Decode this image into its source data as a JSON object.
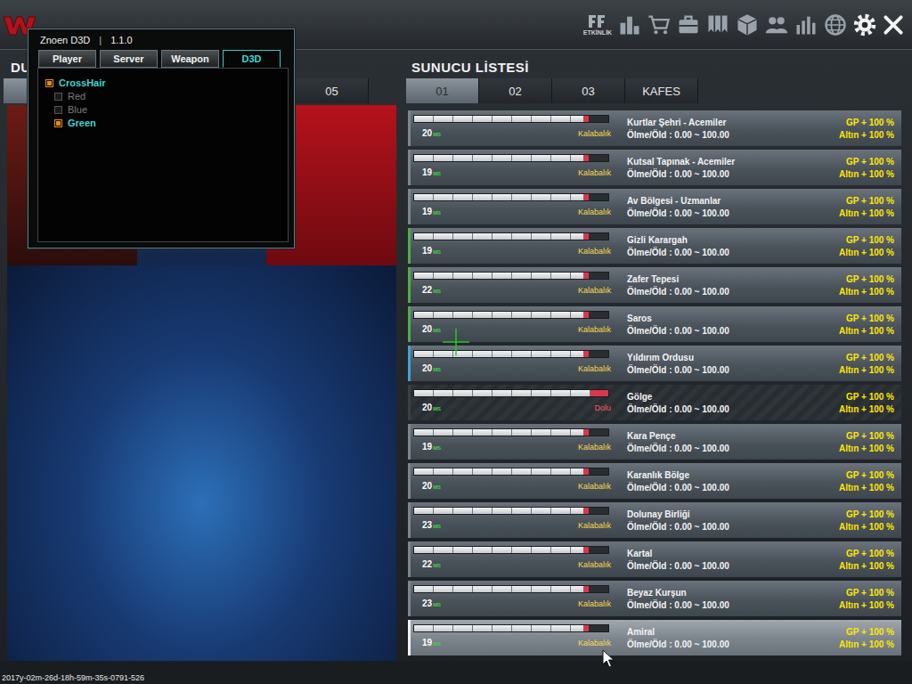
{
  "top_bar": {
    "event_label": "ETKİNLİK"
  },
  "left_panel": {
    "heading": "DU",
    "tabs": [
      {
        "label": "",
        "selected": true
      },
      {
        "label": "",
        "selected": false
      },
      {
        "label": "",
        "selected": false
      },
      {
        "label": "",
        "selected": false
      },
      {
        "label": "05",
        "selected": false
      }
    ]
  },
  "server_list": {
    "title": "SUNUCU LİSTESİ",
    "tabs": [
      {
        "label": "01",
        "selected": true
      },
      {
        "label": "02",
        "selected": false
      },
      {
        "label": "03",
        "selected": false
      },
      {
        "label": "KAFES",
        "selected": false
      }
    ],
    "rows": [
      {
        "name": "Kurtlar Şehri - Acemiler",
        "ping": "20",
        "ping_unit": "MS",
        "status": "Kalabalık",
        "ratio": "Ölme/Öld : 0.00 ~ 100.00",
        "gp": "GP + 100 %",
        "gold": "Altın + 100 %",
        "level": 0.9,
        "full": false,
        "selected": false,
        "color": "#7d868e"
      },
      {
        "name": "Kutsal Tapınak - Acemiler",
        "ping": "19",
        "ping_unit": "MS",
        "status": "Kalabalık",
        "ratio": "Ölme/Öld : 0.00 ~ 100.00",
        "gp": "GP + 100 %",
        "gold": "Altın + 100 %",
        "level": 0.9,
        "full": false,
        "selected": false,
        "color": "#7d868e"
      },
      {
        "name": "Av Bölgesi - Uzmanlar",
        "ping": "19",
        "ping_unit": "MS",
        "status": "Kalabalık",
        "ratio": "Ölme/Öld : 0.00 ~ 100.00",
        "gp": "GP + 100 %",
        "gold": "Altın + 100 %",
        "level": 0.9,
        "full": false,
        "selected": false,
        "color": "#7d868e"
      },
      {
        "name": "Gizli Karargah",
        "ping": "19",
        "ping_unit": "MS",
        "status": "Kalabalık",
        "ratio": "Ölme/Öld : 0.00 ~ 100.00",
        "gp": "GP + 100 %",
        "gold": "Altın + 100 %",
        "level": 0.9,
        "full": false,
        "selected": false,
        "color": "#4fae4a"
      },
      {
        "name": "Zafer Tepesi",
        "ping": "22",
        "ping_unit": "MS",
        "status": "Kalabalık",
        "ratio": "Ölme/Öld : 0.00 ~ 100.00",
        "gp": "GP + 100 %",
        "gold": "Altın + 100 %",
        "level": 0.9,
        "full": false,
        "selected": false,
        "color": "#4fae4a"
      },
      {
        "name": "Saros",
        "ping": "20",
        "ping_unit": "MS",
        "status": "Kalabalık",
        "ratio": "Ölme/Öld : 0.00 ~ 100.00",
        "gp": "GP + 100 %",
        "gold": "Altın + 100 %",
        "level": 0.9,
        "full": false,
        "selected": false,
        "color": "#4fae4a"
      },
      {
        "name": "Yıldırım Ordusu",
        "ping": "20",
        "ping_unit": "MS",
        "status": "Kalabalık",
        "ratio": "Ölme/Öld : 0.00 ~ 100.00",
        "gp": "GP + 100 %",
        "gold": "Altın + 100 %",
        "level": 0.9,
        "full": false,
        "selected": false,
        "color": "#3fa4d8"
      },
      {
        "name": "Gölge",
        "ping": "20",
        "ping_unit": "MS",
        "status": "Dolu",
        "ratio": "Ölme/Öld : 0.00 ~ 100.00",
        "gp": "GP + 100 %",
        "gold": "Altın + 100 %",
        "level": 1,
        "full": true,
        "selected": false,
        "color": "#3a4046"
      },
      {
        "name": "Kara Pençe",
        "ping": "19",
        "ping_unit": "MS",
        "status": "Kalabalık",
        "ratio": "Ölme/Öld : 0.00 ~ 100.00",
        "gp": "GP + 100 %",
        "gold": "Altın + 100 %",
        "level": 0.9,
        "full": false,
        "selected": false,
        "color": "#7d868e"
      },
      {
        "name": "Karanlık Bölge",
        "ping": "20",
        "ping_unit": "MS",
        "status": "Kalabalık",
        "ratio": "Ölme/Öld : 0.00 ~ 100.00",
        "gp": "GP + 100 %",
        "gold": "Altın + 100 %",
        "level": 0.9,
        "full": false,
        "selected": false,
        "color": "#7d868e"
      },
      {
        "name": "Dolunay Birliği",
        "ping": "23",
        "ping_unit": "MS",
        "status": "Kalabalık",
        "ratio": "Ölme/Öld : 0.00 ~ 100.00",
        "gp": "GP + 100 %",
        "gold": "Altın + 100 %",
        "level": 0.9,
        "full": false,
        "selected": false,
        "color": "#7d868e"
      },
      {
        "name": "Kartal",
        "ping": "22",
        "ping_unit": "MS",
        "status": "Kalabalık",
        "ratio": "Ölme/Öld : 0.00 ~ 100.00",
        "gp": "GP + 100 %",
        "gold": "Altın + 100 %",
        "level": 0.9,
        "full": false,
        "selected": false,
        "color": "#7d868e"
      },
      {
        "name": "Beyaz Kurşun",
        "ping": "23",
        "ping_unit": "MS",
        "status": "Kalabalık",
        "ratio": "Ölme/Öld : 0.00 ~ 100.00",
        "gp": "GP + 100 %",
        "gold": "Altın + 100 %",
        "level": 0.9,
        "full": false,
        "selected": false,
        "color": "#7d868e"
      },
      {
        "name": "Amiral",
        "ping": "19",
        "ping_unit": "MS",
        "status": "Kalabalık",
        "ratio": "Ölme/Öld : 0.00 ~ 100.00",
        "gp": "GP + 100 %",
        "gold": "Altın + 100 %",
        "level": 0.9,
        "full": false,
        "selected": true,
        "color": "#f2f2f2"
      }
    ]
  },
  "timestamp": "2017y-02m-26d-18h-59m-35s-0791-526",
  "cheat_menu": {
    "title": "Znoen D3D",
    "separator": "|",
    "version": "1.1.0",
    "tabs": [
      {
        "label": "Player",
        "selected": false
      },
      {
        "label": "Server",
        "selected": false
      },
      {
        "label": "Weapon",
        "selected": false
      },
      {
        "label": "D3D",
        "selected": true
      }
    ],
    "tree": {
      "label": "CrossHair",
      "checked": true,
      "children": [
        {
          "label": "Red",
          "checked": false,
          "color": "#e53935"
        },
        {
          "label": "Blue",
          "checked": false,
          "color": "#2f6fe0"
        },
        {
          "label": "Green",
          "checked": true,
          "color": "#22c922"
        }
      ]
    }
  }
}
